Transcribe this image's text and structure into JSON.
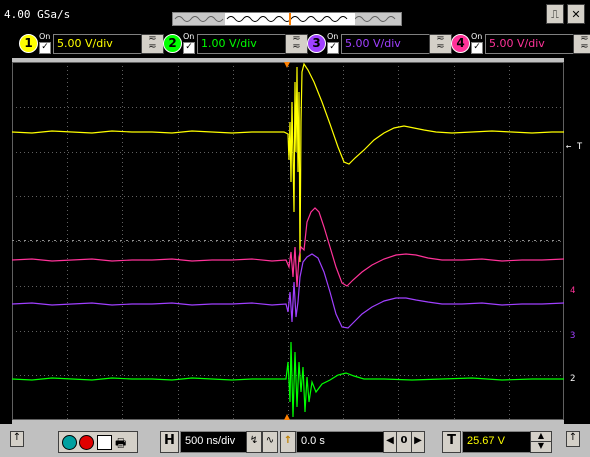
{
  "acquisition": {
    "sample_rate": "4.00 GSa/s"
  },
  "window_buttons": {
    "restore": "⎍",
    "close": "✕"
  },
  "channels": [
    {
      "number": "1",
      "on_label": "On",
      "scale": "5.00 V/div",
      "color": "#ffff00"
    },
    {
      "number": "2",
      "on_label": "On",
      "scale": "1.00 V/div",
      "color": "#00ff00"
    },
    {
      "number": "3",
      "on_label": "On",
      "scale": "5.00 V/div",
      "color": "#a040ff"
    },
    {
      "number": "4",
      "on_label": "On",
      "scale": "5.00 V/div",
      "color": "#ff3399"
    }
  ],
  "markers": {
    "trigger": "← T",
    "ch4": "4",
    "ch3": "3",
    "ch2": "2"
  },
  "bottom": {
    "horizontal_label": "H",
    "horizontal_scale": "500 ns/div",
    "delay_value": "0.0 s",
    "delay_zero": "0",
    "trigger_label": "T",
    "trigger_level": "25.67 V"
  }
}
